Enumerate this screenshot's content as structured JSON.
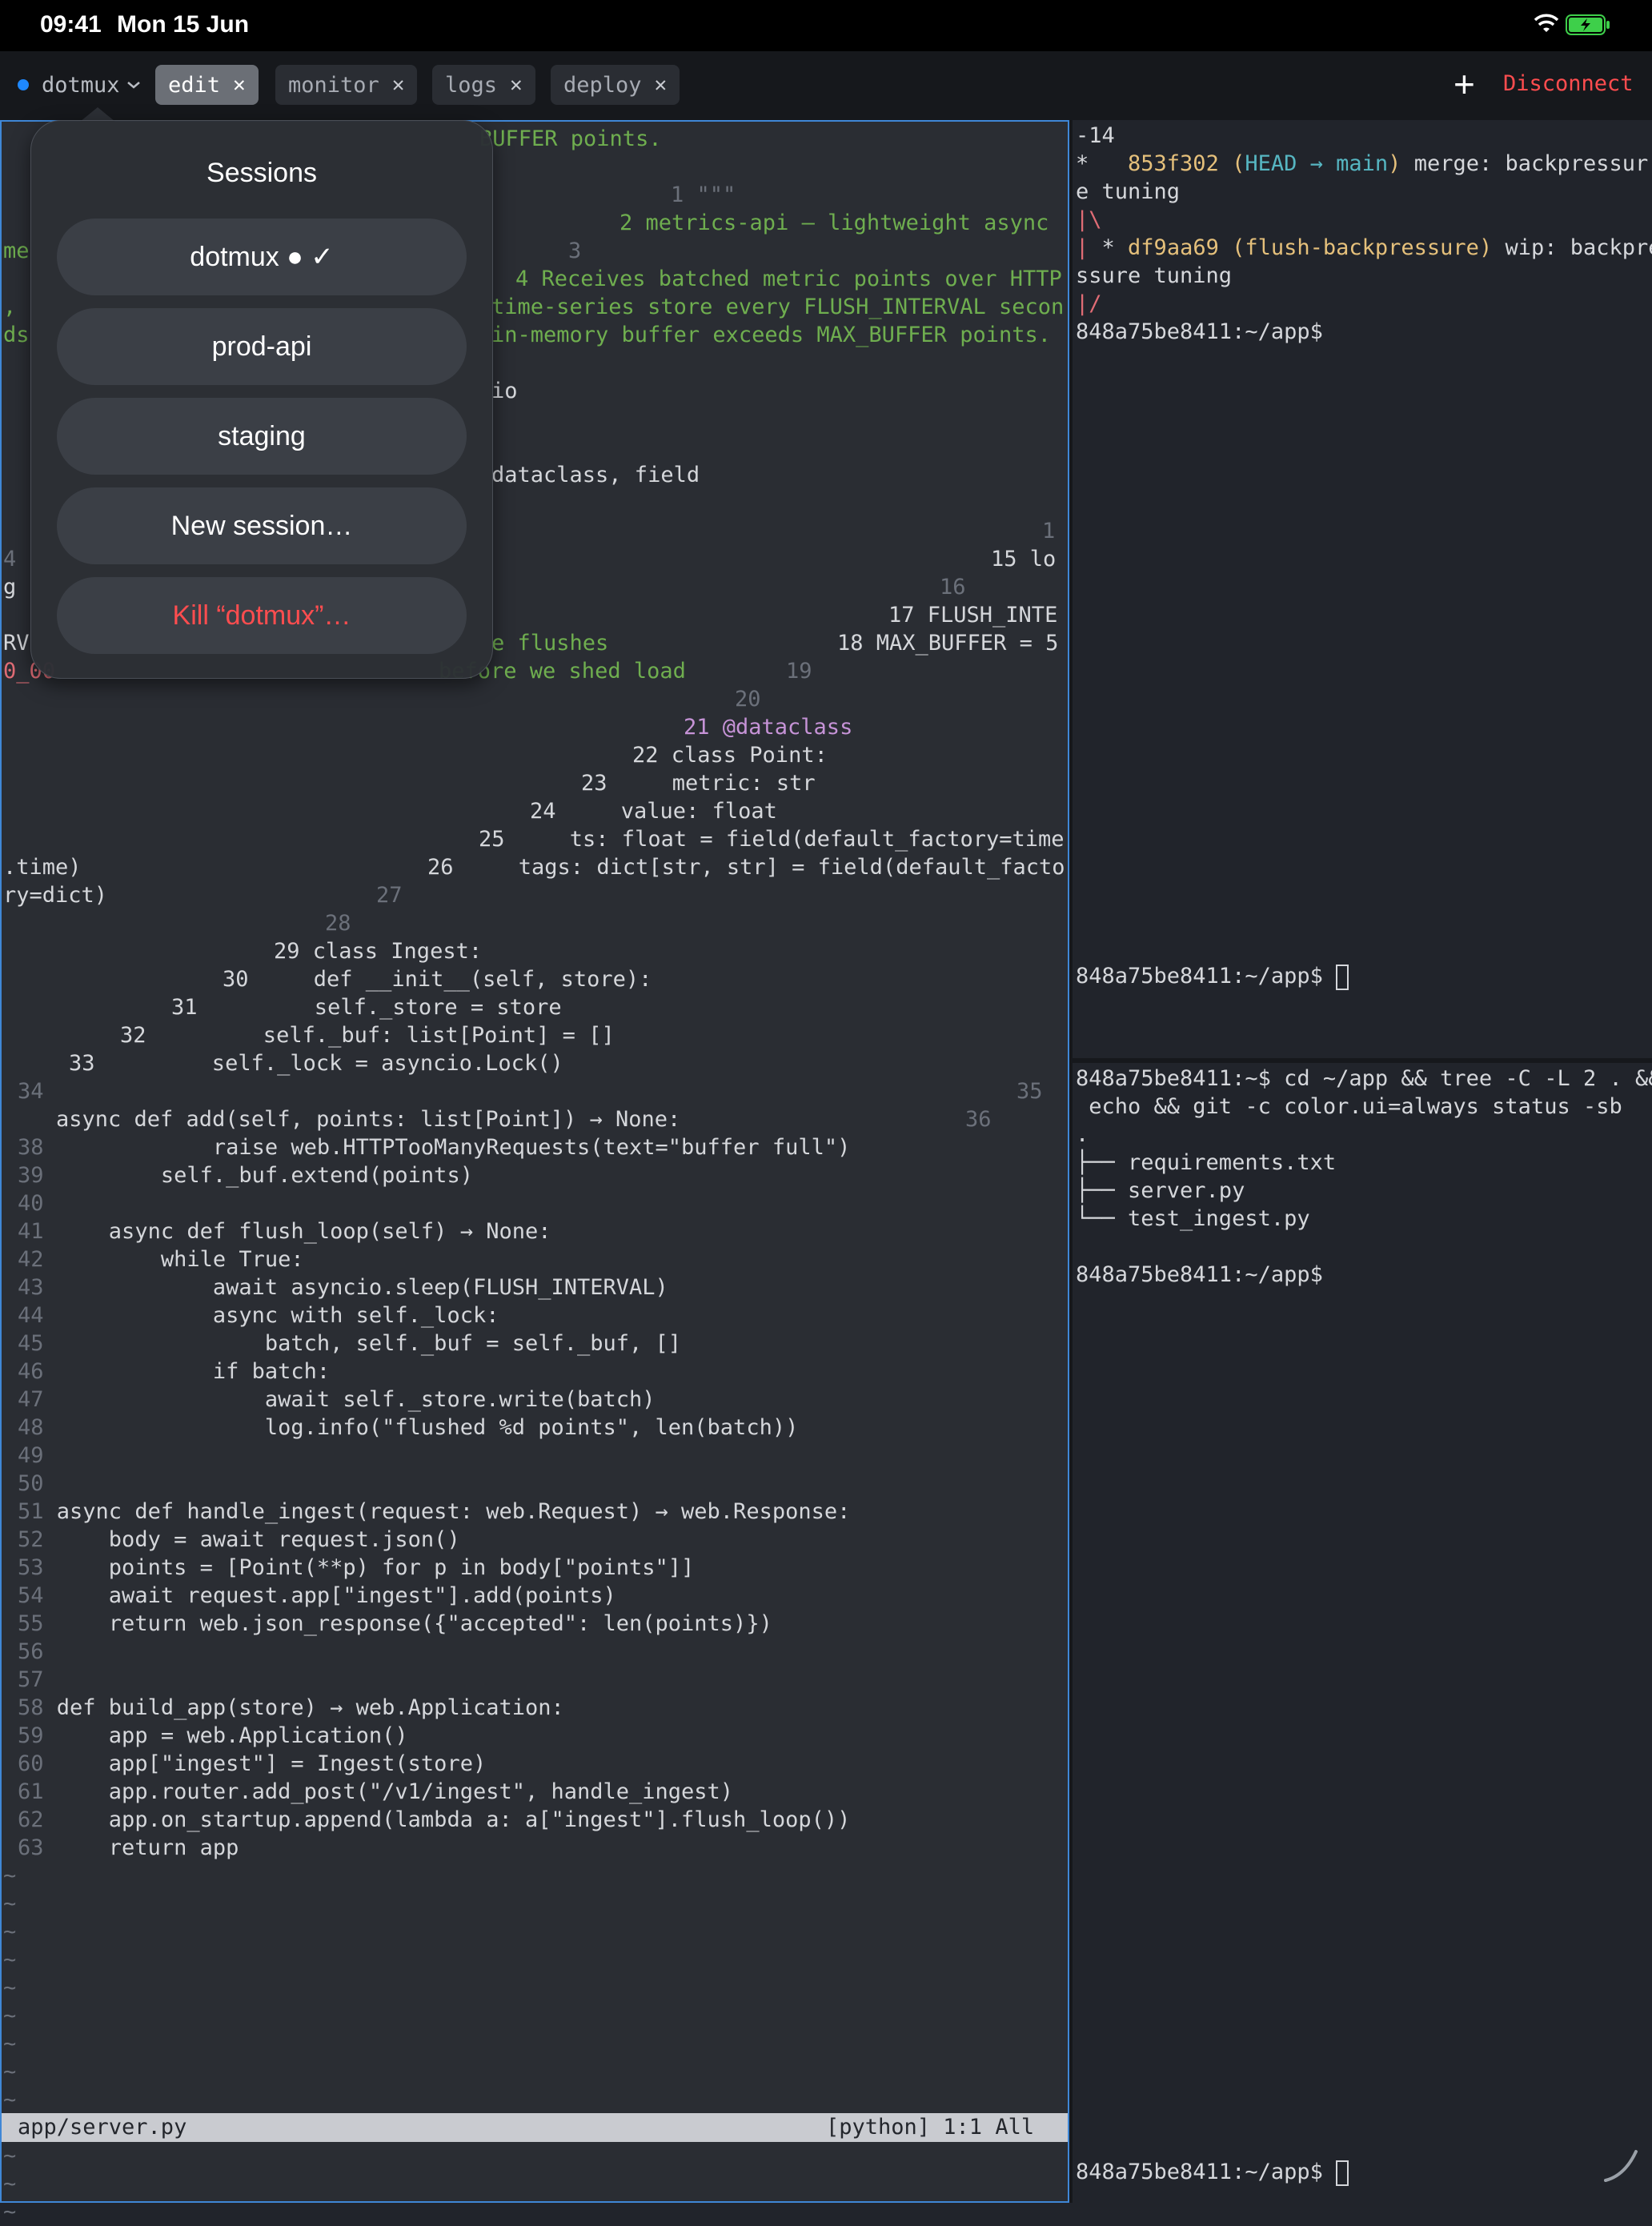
{
  "status_bar": {
    "time": "09:41",
    "date": "Mon 15 Jun"
  },
  "tab_bar": {
    "session_label": "dotmux",
    "tabs": [
      {
        "label": "edit",
        "active": true
      },
      {
        "label": "monitor",
        "active": false
      },
      {
        "label": "logs",
        "active": false
      },
      {
        "label": "deploy",
        "active": false
      }
    ],
    "close_glyph": "✕",
    "add_glyph": "+",
    "disconnect_label": "Disconnect"
  },
  "sessions_popover": {
    "title": "Sessions",
    "items": [
      "dotmux ● ✓",
      "prod-api",
      "staging",
      "New session…",
      "Kill “dotmux”…"
    ]
  },
  "editor": {
    "line_fragments": [
      "BUFFER points.",
      "1 \"\"\"",
      "2 metrics-api — lightweight async",
      "me",
      "3",
      "4 Receives batched metric points over HTTP",
      ",",
      "time-series store every FLUSH_INTERVAL secon",
      "ds",
      "in-memory buffer exceeds MAX_BUFFER points.",
      "io",
      "dataclass, field",
      "1",
      "4",
      "15 lo",
      "g",
      "16",
      "17 FLUSH_INTE",
      "RV",
      "e flushes",
      "18 MAX_BUFFER = 5",
      "0_00",
      "before we shed load",
      "19",
      "20",
      "21 @dataclass",
      "22 class Point:",
      "23     metric: str",
      "24     value: float",
      "25     ts: float = field(default_factory=time",
      ".time)",
      "26     tags: dict[str, str] = field(default_facto",
      "ry=dict)",
      "27",
      "28",
      "29 class Ingest:",
      "30     def __init__(self, store):",
      "31         self._store = store",
      "32         self._buf: list[Point] = []",
      "33         self._lock = asyncio.Lock()",
      "34",
      "35",
      "async def add(self, points: list[Point]) → None:",
      "36"
    ],
    "lines": [
      {
        "n": "38",
        "text": "            raise web.HTTPTooManyRequests(text=\"buffer full\")"
      },
      {
        "n": "39",
        "text": "        self._buf.extend(points)"
      },
      {
        "n": "40",
        "text": ""
      },
      {
        "n": "41",
        "text": "    async def flush_loop(self) → None:"
      },
      {
        "n": "42",
        "text": "        while True:"
      },
      {
        "n": "43",
        "text": "            await asyncio.sleep(FLUSH_INTERVAL)"
      },
      {
        "n": "44",
        "text": "            async with self._lock:"
      },
      {
        "n": "45",
        "text": "                batch, self._buf = self._buf, []"
      },
      {
        "n": "46",
        "text": "            if batch:"
      },
      {
        "n": "47",
        "text": "                await self._store.write(batch)"
      },
      {
        "n": "48",
        "text": "                log.info(\"flushed %d points\", len(batch))"
      },
      {
        "n": "49",
        "text": ""
      },
      {
        "n": "50",
        "text": ""
      },
      {
        "n": "51",
        "text": "async def handle_ingest(request: web.Request) → web.Response:"
      },
      {
        "n": "52",
        "text": "    body = await request.json()"
      },
      {
        "n": "53",
        "text": "    points = [Point(**p) for p in body[\"points\"]]"
      },
      {
        "n": "54",
        "text": "    await request.app[\"ingest\"].add(points)"
      },
      {
        "n": "55",
        "text": "    return web.json_response({\"accepted\": len(points)})"
      },
      {
        "n": "56",
        "text": ""
      },
      {
        "n": "57",
        "text": ""
      },
      {
        "n": "58",
        "text": "def build_app(store) → web.Application:"
      },
      {
        "n": "59",
        "text": "    app = web.Application()"
      },
      {
        "n": "60",
        "text": "    app[\"ingest\"] = Ingest(store)"
      },
      {
        "n": "61",
        "text": "    app.router.add_post(\"/v1/ingest\", handle_ingest)"
      },
      {
        "n": "62",
        "text": "    app.on_startup.append(lambda a: a[\"ingest\"].flush_loop())"
      },
      {
        "n": "63",
        "text": "    return app"
      }
    ],
    "tilde": "~",
    "status_left": "app/server.py",
    "status_right": "[python]  1:1   All"
  },
  "terminal_top": {
    "lines": [
      "-14",
      "*   853f302 (HEAD → main) merge: backpressur",
      "e tuning",
      "|\\",
      "| * df9aa69 (flush-backpressure) wip: backpre",
      "ssure tuning",
      "|/",
      "848a75be8411:~/app$"
    ],
    "prompt": "848a75be8411:~/app$ "
  },
  "terminal_bottom": {
    "lines": [
      "848a75be8411:~$ cd ~/app && tree -C -L 2 . &&",
      " echo && git -c color.ui=always status -sb",
      ".",
      "├── requirements.txt",
      "├── server.py",
      "└── test_ingest.py",
      "",
      "848a75be8411:~/app$"
    ],
    "prompt": "848a75be8411:~/app$ "
  }
}
